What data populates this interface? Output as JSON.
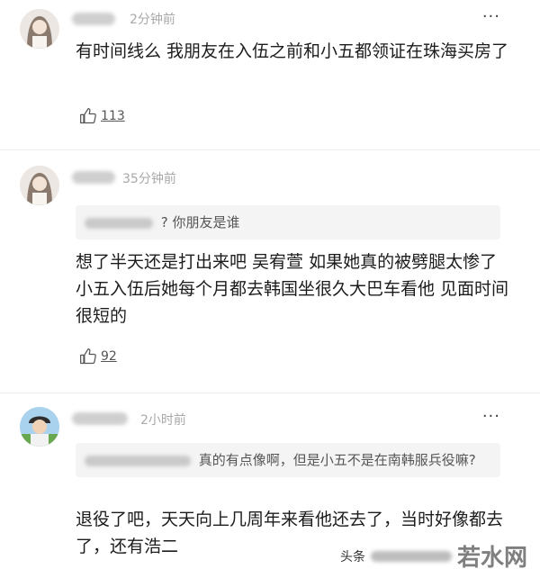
{
  "comments": [
    {
      "time": "2分钟前",
      "more": "···",
      "text": "有时间线么 我朋友在入伍之前和小五都领证在珠海买房了",
      "likes": "113"
    },
    {
      "time": "35分钟前",
      "more": "···",
      "quote": "? 你朋友是谁",
      "text": "想了半天还是打出来吧 吴宥萱 如果她真的被劈腿太惨了 小五入伍后她每个月都去韩国坐很久大巴车看他 见面时间很短的",
      "likes": "92"
    },
    {
      "time": "2小时前",
      "more": "···",
      "quote": "真的有点像啊，但是小五不是在南韩服兵役嘛?",
      "text": "退役了吧，天天向上几周年来看他还去了，当时好像都去了，还有浩二"
    }
  ],
  "watermark": {
    "source": "头条",
    "brand": "若水网"
  },
  "icons": {
    "like": "thumbs-up-icon",
    "more": "more-dots-icon"
  }
}
